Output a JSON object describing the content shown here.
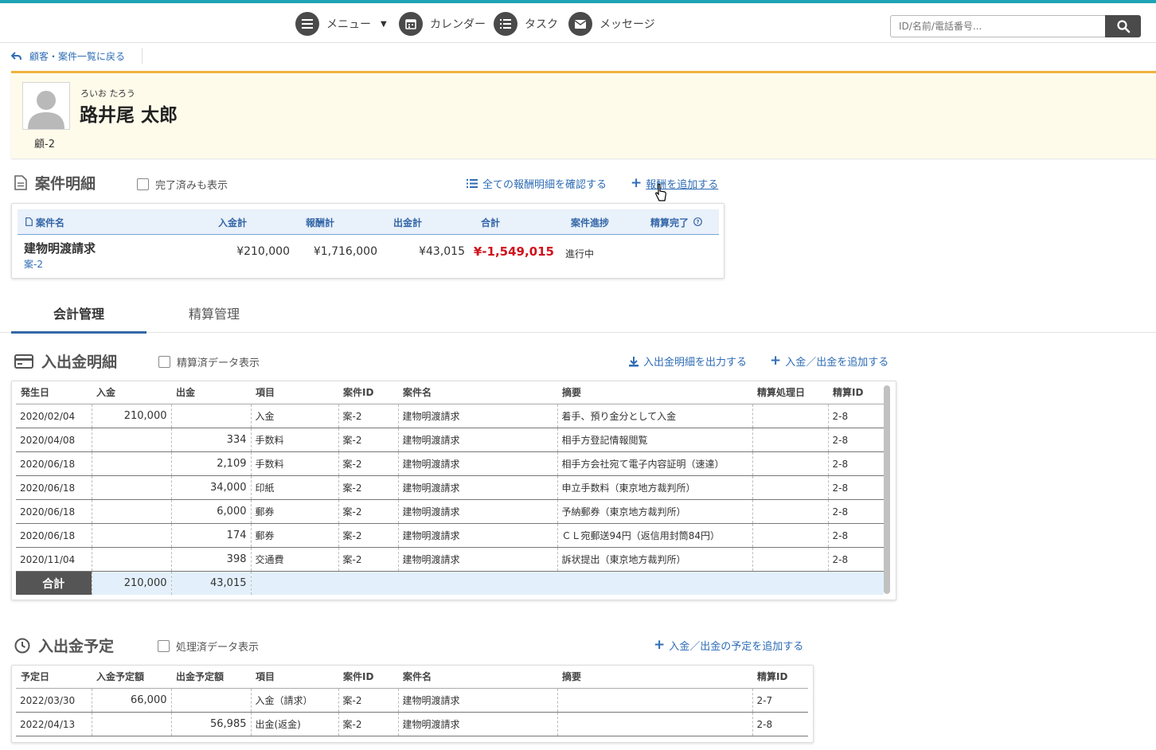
{
  "nav": {
    "menu": "メニュー",
    "calendar": "カレンダー",
    "task": "タスク",
    "message": "メッセージ",
    "search_placeholder": "ID/名前/電話番号..."
  },
  "back_link": "顧客・案件一覧に戻る",
  "customer": {
    "ruby": "ろいお たろう",
    "name": "路井尾 太郎",
    "id": "顧-2"
  },
  "case_section": {
    "title": "案件明細",
    "show_completed": "完了済みも表示",
    "view_all": "全ての報酬明細を確認する",
    "add_fee": "報酬を追加する",
    "headers": [
      "案件名",
      "入金計",
      "報酬計",
      "出金計",
      "合計",
      "案件進捗",
      "精算完了"
    ],
    "row": {
      "name": "建物明渡請求",
      "case_id": "案-2",
      "deposit": "¥210,000",
      "fee": "¥1,716,000",
      "withdrawal": "¥43,015",
      "total": "¥-1,549,015",
      "status": "進行中"
    }
  },
  "tabs": [
    "会計管理",
    "精算管理"
  ],
  "ledger": {
    "title": "入出金明細",
    "show_settled": "精算済データ表示",
    "export": "入出金明細を出力する",
    "add": "入金／出金を追加する",
    "headers": [
      "発生日",
      "入金",
      "出金",
      "項目",
      "案件ID",
      "案件名",
      "摘要",
      "精算処理日",
      "精算ID"
    ],
    "rows": [
      [
        "2020/02/04",
        "210,000",
        "",
        "入金",
        "案-2",
        "建物明渡請求",
        "着手、預り金分として入金",
        "",
        "2-8"
      ],
      [
        "2020/04/08",
        "",
        "334",
        "手数料",
        "案-2",
        "建物明渡請求",
        "相手方登記情報閲覧",
        "",
        "2-8"
      ],
      [
        "2020/06/18",
        "",
        "2,109",
        "手数料",
        "案-2",
        "建物明渡請求",
        "相手方会社宛て電子内容証明（速達）",
        "",
        "2-8"
      ],
      [
        "2020/06/18",
        "",
        "34,000",
        "印紙",
        "案-2",
        "建物明渡請求",
        "申立手数料（東京地方裁判所）",
        "",
        "2-8"
      ],
      [
        "2020/06/18",
        "",
        "6,000",
        "郵券",
        "案-2",
        "建物明渡請求",
        "予納郵券（東京地方裁判所）",
        "",
        "2-8"
      ],
      [
        "2020/06/18",
        "",
        "174",
        "郵券",
        "案-2",
        "建物明渡請求",
        "ＣＬ宛郵送94円（返信用封筒84円）",
        "",
        "2-8"
      ],
      [
        "2020/11/04",
        "",
        "398",
        "交通費",
        "案-2",
        "建物明渡請求",
        "訴状提出（東京地方裁判所）",
        "",
        "2-8"
      ]
    ],
    "sum_label": "合計",
    "sum_deposit": "210,000",
    "sum_withdrawal": "43,015"
  },
  "schedule": {
    "title": "入出金予定",
    "show_processed": "処理済データ表示",
    "add": "入金／出金の予定を追加する",
    "headers": [
      "予定日",
      "入金予定額",
      "出金予定額",
      "項目",
      "案件ID",
      "案件名",
      "摘要",
      "精算ID"
    ],
    "rows": [
      [
        "2022/03/30",
        "66,000",
        "",
        "入金（請求）",
        "案-2",
        "建物明渡請求",
        "",
        "2-7"
      ],
      [
        "2022/04/13",
        "",
        "56,985",
        "出金(返金)",
        "案-2",
        "建物明渡請求",
        "",
        "2-8"
      ]
    ]
  },
  "colors": {
    "accent_teal": "#1fa3b6",
    "link_blue": "#2f6db5",
    "negative_red": "#d0121b",
    "profile_border": "#f0b33c"
  }
}
